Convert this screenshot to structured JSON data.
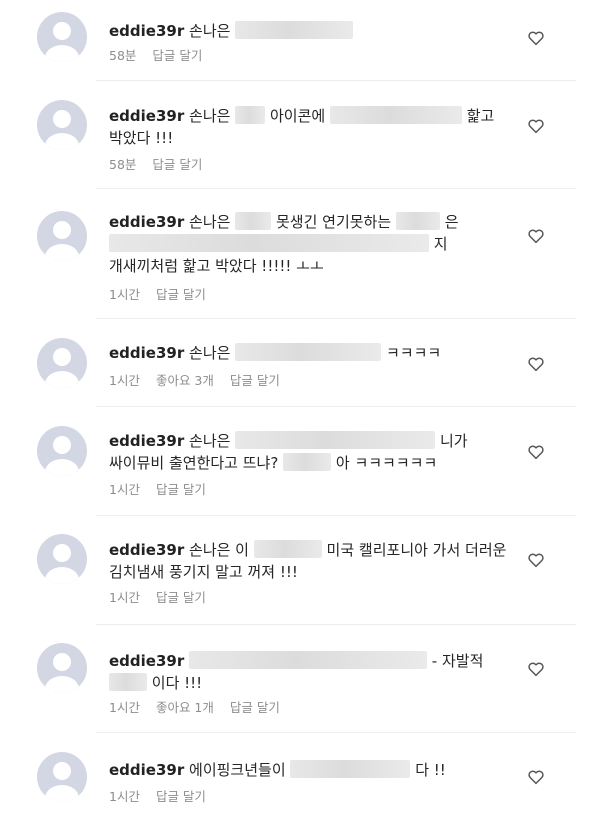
{
  "comments": [
    {
      "username": "eddie39r",
      "segments": [
        "손나은",
        "",
        "",
        ""
      ],
      "time": "58분",
      "likes": "",
      "reply_label": "답글 달기"
    },
    {
      "username": "eddie39r",
      "segments": [
        "손나은",
        "아이콘에",
        "핥고",
        "박았다 !!!"
      ],
      "time": "58분",
      "likes": "",
      "reply_label": "답글 달기"
    },
    {
      "username": "eddie39r",
      "segments": [
        "손나은",
        "못생긴 연기못하는",
        "은",
        "지",
        "개새끼처럼 핥고 박았다 !!!!! ㅗㅗ"
      ],
      "time": "1시간",
      "likes": "",
      "reply_label": "답글 달기"
    },
    {
      "username": "eddie39r",
      "segments": [
        "손나은",
        "ㅋㅋㅋㅋ"
      ],
      "time": "1시간",
      "likes": "좋아요 3개",
      "reply_label": "답글 달기"
    },
    {
      "username": "eddie39r",
      "segments": [
        "손나은",
        "니가",
        "싸이뮤비 출연한다고 뜨냐?",
        "아 ㅋㅋㅋㅋㅋㅋ"
      ],
      "time": "1시간",
      "likes": "",
      "reply_label": "답글 달기"
    },
    {
      "username": "eddie39r",
      "segments": [
        "손나은 이",
        "미국 캘리포니아 가서 더러운",
        "김치냄새 풍기지 말고 꺼져 !!!"
      ],
      "time": "1시간",
      "likes": "",
      "reply_label": "답글 달기"
    },
    {
      "username": "eddie39r",
      "segments": [
        "- 자발적",
        "이다 !!!"
      ],
      "time": "1시간",
      "likes": "좋아요 1개",
      "reply_label": "답글 달기"
    },
    {
      "username": "eddie39r",
      "segments": [
        "에이핑크년들이",
        "다 !!"
      ],
      "time": "1시간",
      "likes": "",
      "reply_label": "답글 달기"
    }
  ]
}
